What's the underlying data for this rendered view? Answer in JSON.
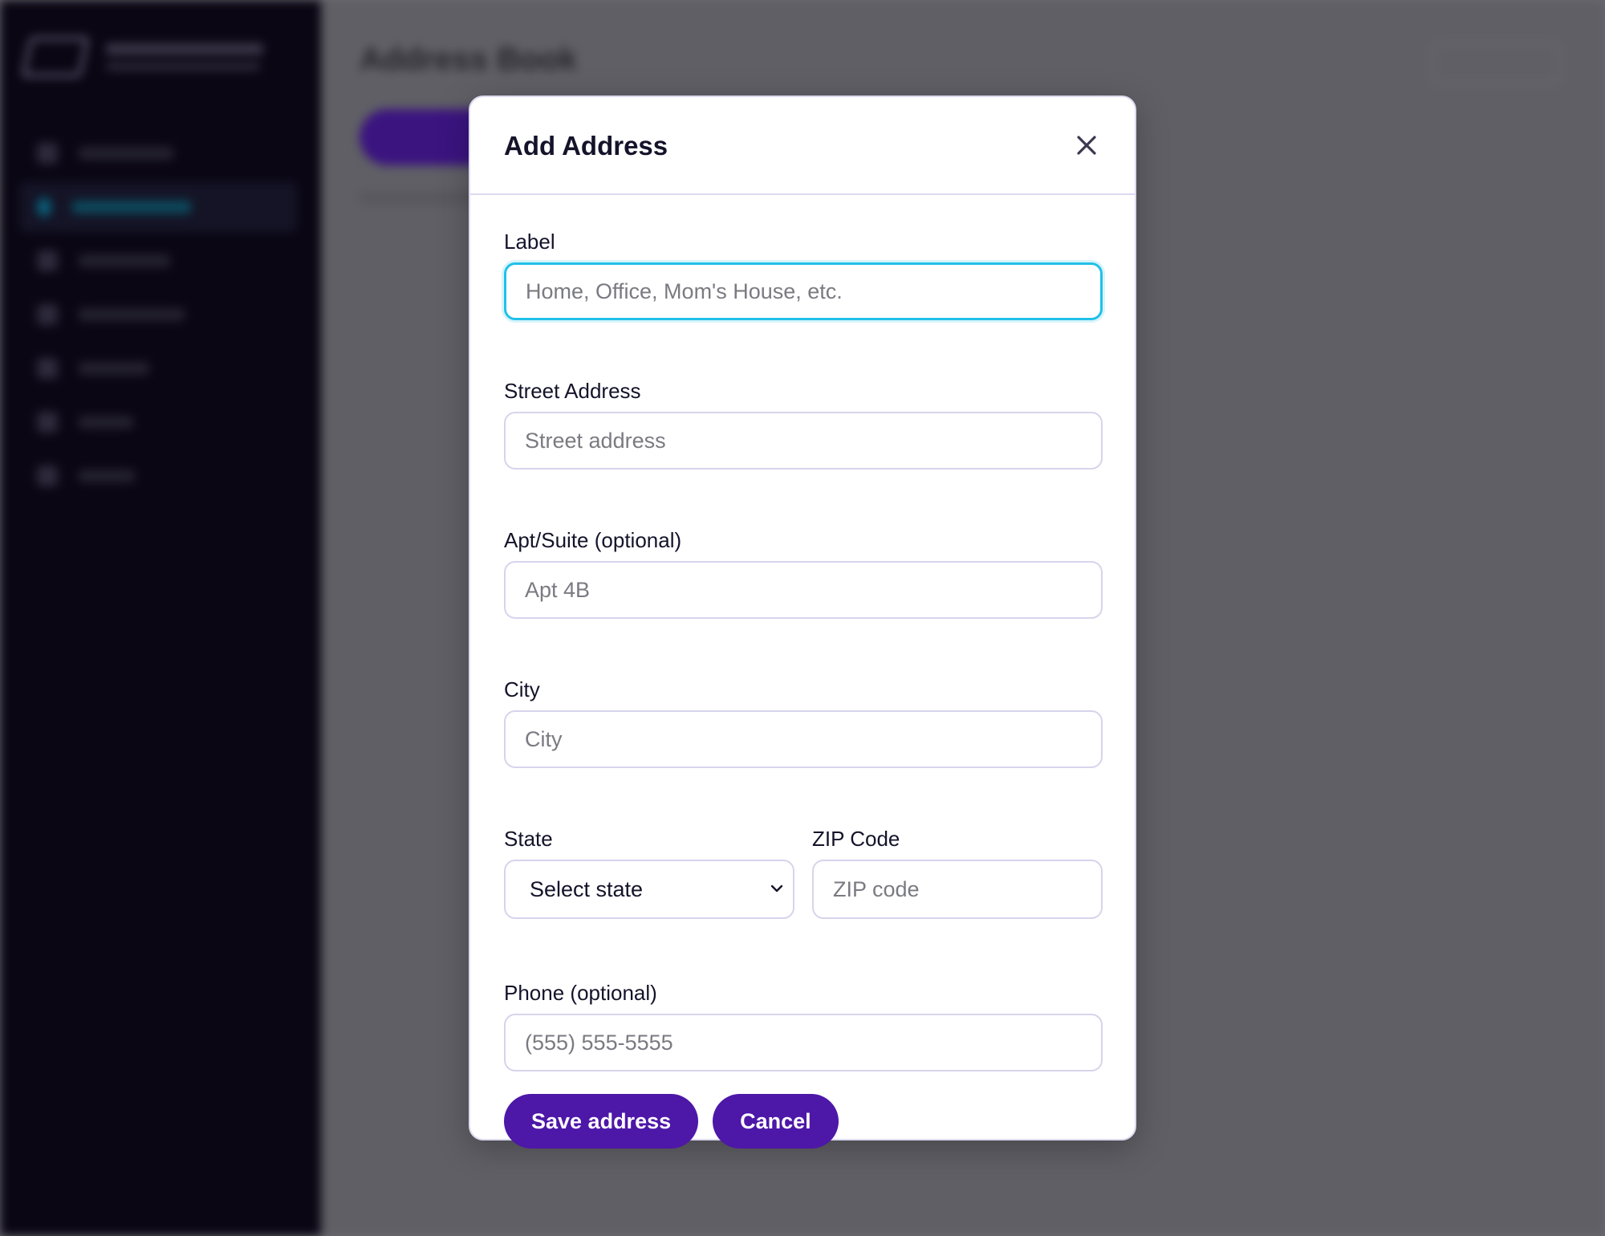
{
  "background": {
    "page_title": "Address Book"
  },
  "modal": {
    "title": "Add Address",
    "close_icon": "close-icon",
    "fields": {
      "label": {
        "label": "Label",
        "placeholder": "Home, Office, Mom's House, etc.",
        "value": ""
      },
      "street": {
        "label": "Street Address",
        "placeholder": "Street address",
        "value": ""
      },
      "apt": {
        "label": "Apt/Suite (optional)",
        "placeholder": "Apt 4B",
        "value": ""
      },
      "city": {
        "label": "City",
        "placeholder": "City",
        "value": ""
      },
      "state": {
        "label": "State",
        "selected": "Select state"
      },
      "zip": {
        "label": "ZIP Code",
        "placeholder": "ZIP code",
        "value": ""
      },
      "phone": {
        "label": "Phone (optional)",
        "placeholder": "(555) 555-5555",
        "value": ""
      }
    },
    "actions": {
      "save_label": "Save address",
      "cancel_label": "Cancel"
    }
  },
  "colors": {
    "primary": "#4d17a8",
    "focus_ring": "#22c0e8",
    "sidebar": "#0a0614",
    "overlay": "#6a6a70"
  }
}
